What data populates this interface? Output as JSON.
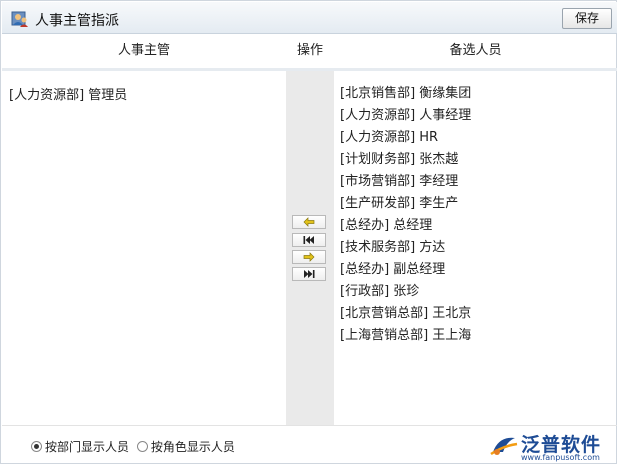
{
  "window": {
    "title": "人事主管指派",
    "save_label": "保存"
  },
  "columns": {
    "left": "人事主管",
    "middle": "操作",
    "right": "备选人员"
  },
  "assigned": [
    "[人力资源部] 管理员"
  ],
  "candidates": [
    "[北京销售部] 衡缘集团",
    "[人力资源部] 人事经理",
    "[人力资源部] HR",
    "[计划财务部] 张杰越",
    "[市场营销部] 李经理",
    "[生产研发部] 李生产",
    "[总经办] 总经理",
    "[技术服务部] 方达",
    "[总经办] 副总经理",
    "[行政部] 张珍",
    "[北京营销总部] 王北京",
    "[上海营销总部] 王上海"
  ],
  "controls": [
    {
      "icon": "arrow-left-icon"
    },
    {
      "icon": "double-arrow-left-icon"
    },
    {
      "icon": "arrow-right-icon"
    },
    {
      "icon": "double-arrow-right-icon"
    }
  ],
  "display_mode": {
    "options": [
      "按部门显示人员",
      "按角色显示人员"
    ],
    "selected": "按部门显示人员"
  },
  "logo": {
    "name": "泛普软件",
    "url": "www.fanpusoft.com"
  },
  "colors": {
    "arrow": "#e2c21a",
    "logo": "#1e4c95",
    "middle_panel": "#eaeaea"
  }
}
